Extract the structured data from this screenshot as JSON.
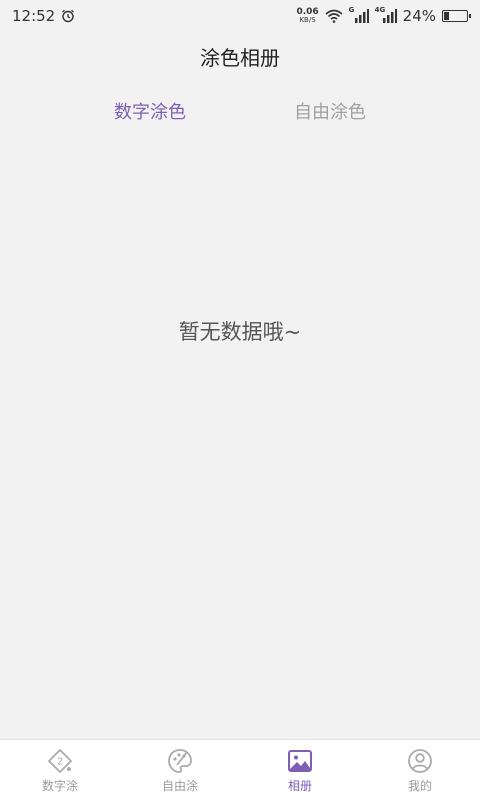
{
  "status_bar": {
    "time": "12:52",
    "net_speed_value": "0.06",
    "net_speed_unit": "KB/S",
    "signal1_label": "G",
    "signal2_label": "4G",
    "battery_percent_text": "24%",
    "battery_level": 0.24,
    "alarm_icon": "alarm-clock-icon",
    "wifi_icon": "wifi-icon"
  },
  "header": {
    "title": "涂色相册"
  },
  "tabs": [
    {
      "label": "数字涂色",
      "active": true
    },
    {
      "label": "自由涂色",
      "active": false
    }
  ],
  "empty_state": {
    "message": "暂无数据哦~"
  },
  "bottom_nav": [
    {
      "label": "数字涂",
      "icon": "number-paint-icon",
      "active": false
    },
    {
      "label": "自由涂",
      "icon": "palette-icon",
      "active": false
    },
    {
      "label": "相册",
      "icon": "gallery-icon",
      "active": true
    },
    {
      "label": "我的",
      "icon": "profile-icon",
      "active": false
    }
  ],
  "colors": {
    "accent": "#7e5fb4",
    "inactive": "#a0a0a0",
    "background": "#f2f2f2"
  }
}
